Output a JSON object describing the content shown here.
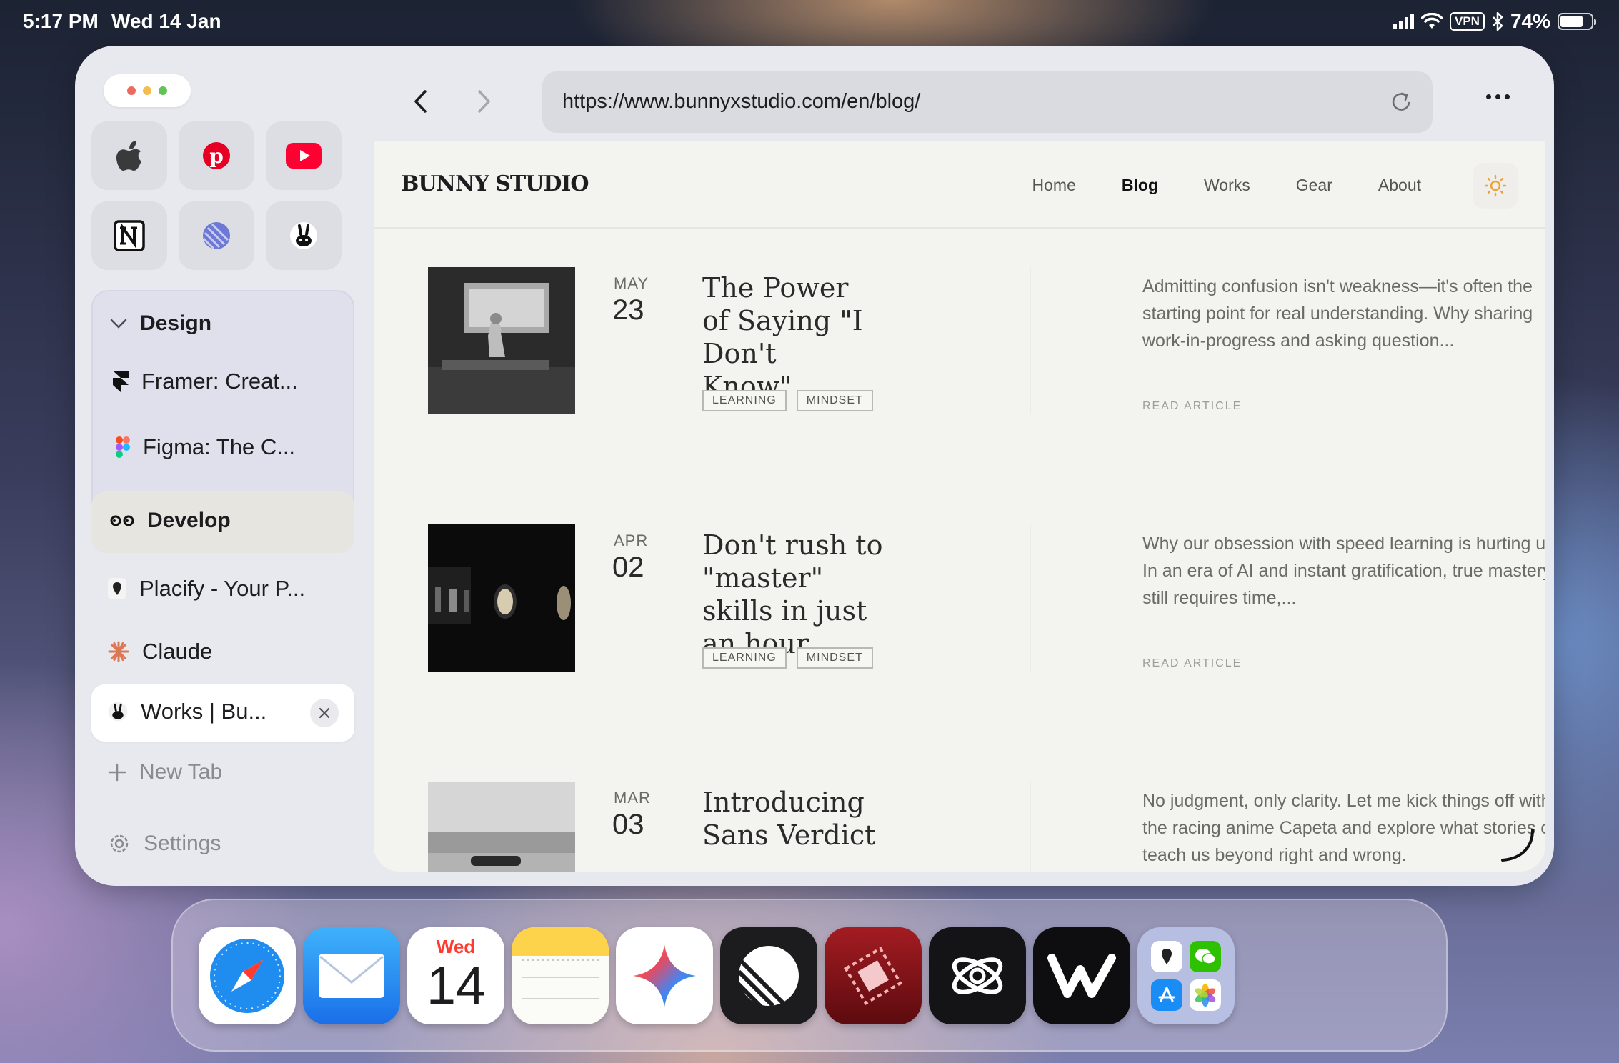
{
  "status_bar": {
    "time": "5:17 PM",
    "date": "Wed 14 Jan",
    "vpn": "VPN",
    "battery": "74%",
    "battery_level": 0.74
  },
  "sidebar": {
    "favorites": [
      {
        "name": "Apple",
        "icon": "apple-icon"
      },
      {
        "name": "Pinterest",
        "icon": "pinterest-icon"
      },
      {
        "name": "YouTube",
        "icon": "youtube-icon"
      },
      {
        "name": "Notion",
        "icon": "notion-icon"
      },
      {
        "name": "Linear",
        "icon": "linear-icon"
      },
      {
        "name": "Bunny Studio",
        "icon": "bunny-icon"
      }
    ],
    "groups": [
      {
        "label": "Design",
        "expanded": true,
        "tabs": [
          {
            "label": "Framer: Creat...",
            "icon": "framer-icon"
          },
          {
            "label": "Figma: The C...",
            "icon": "figma-icon"
          }
        ]
      },
      {
        "label": "Develop",
        "expanded": false
      }
    ],
    "tabs": [
      {
        "label": "Placify - Your P...",
        "icon": "placify-icon"
      },
      {
        "label": "Claude",
        "icon": "claude-icon"
      },
      {
        "label": "Works | Bu...",
        "icon": "bunny-icon",
        "active": true
      }
    ],
    "new_tab_label": "New Tab",
    "settings_label": "Settings"
  },
  "browser": {
    "url": "https://www.bunnyxstudio.com/en/blog/",
    "site": {
      "logo": "BUNNY STUDIO",
      "nav": [
        "Home",
        "Blog",
        "Works",
        "Gear",
        "About"
      ],
      "active_nav": "Blog"
    },
    "posts": [
      {
        "month": "MAY",
        "day": "23",
        "title": "The Power of Saying \"I Don't Know\"",
        "tags": [
          "LEARNING",
          "MINDSET"
        ],
        "excerpt": "Admitting confusion isn't weakness—it's often the starting point for real understanding. Why sharing work-in-progress and asking question...",
        "read_label": "READ ARTICLE"
      },
      {
        "month": "APR",
        "day": "02",
        "title": "Don't rush to \"master\" skills in just an hour",
        "tags": [
          "LEARNING",
          "MINDSET"
        ],
        "excerpt": "Why our obsession with speed learning is hurting us. In an era of AI and instant gratification, true mastery still requires time,...",
        "read_label": "READ ARTICLE"
      },
      {
        "month": "MAR",
        "day": "03",
        "title": "Introducing Sans Verdict",
        "excerpt": "No judgment, only clarity. Let me kick things off with the racing anime Capeta and explore what stories can teach us beyond right and wrong."
      }
    ]
  },
  "dock": {
    "apps": [
      {
        "name": "Safari",
        "icon": "safari-icon"
      },
      {
        "name": "Mail",
        "icon": "mail-icon"
      },
      {
        "name": "Calendar",
        "icon": "calendar-icon",
        "weekday": "Wed",
        "day": "14"
      },
      {
        "name": "Notes",
        "icon": "notes-icon"
      },
      {
        "name": "Gemini",
        "icon": "gemini-icon"
      },
      {
        "name": "Linear",
        "icon": "linear-icon"
      },
      {
        "name": "Screens",
        "icon": "screens-icon"
      },
      {
        "name": "Perplexity",
        "icon": "orbit-icon"
      },
      {
        "name": "Warp",
        "icon": "w-icon"
      },
      {
        "name": "App Library",
        "icon": "app-library-icon"
      }
    ]
  },
  "colors": {
    "accent_sun": "#f0a22e",
    "youtube_red": "#ff0033",
    "pinterest_red": "#e60023",
    "linear_purple": "#6e79d6"
  }
}
